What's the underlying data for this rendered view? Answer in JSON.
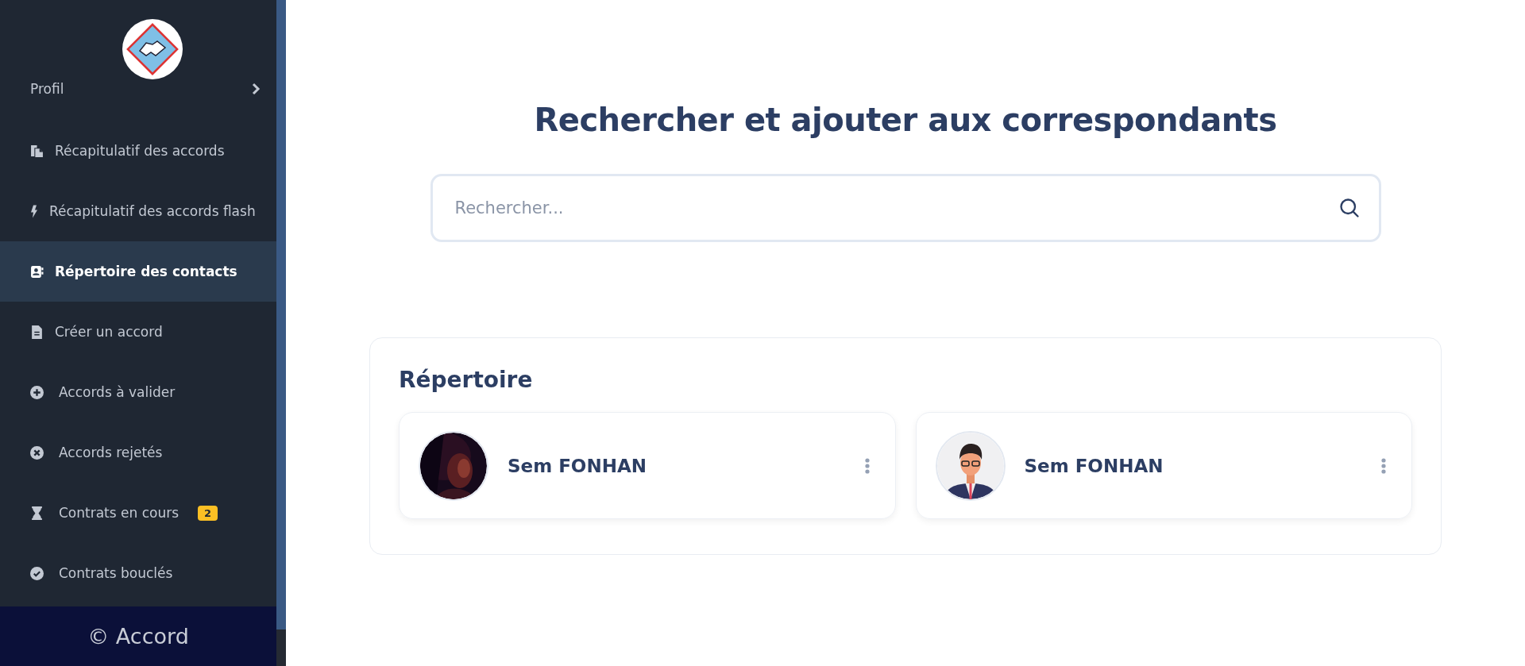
{
  "sidebar": {
    "profile": {
      "label": "Profil"
    },
    "items": [
      {
        "label": "Récapitulatif des accords",
        "selected": false
      },
      {
        "label": "Récapitulatif des accords flash",
        "selected": false
      },
      {
        "label": "Répertoire des contacts",
        "selected": true
      },
      {
        "label": "Créer un accord",
        "selected": false
      },
      {
        "label": "Accords à valider",
        "selected": false
      },
      {
        "label": "Accords rejetés",
        "selected": false
      },
      {
        "label": "Contrats en cours",
        "selected": false,
        "badge": "2"
      },
      {
        "label": "Contrats bouclés",
        "selected": false
      }
    ],
    "footer": "© Accord"
  },
  "main": {
    "title": "Rechercher et ajouter aux correspondants",
    "search": {
      "placeholder": "Rechercher..."
    },
    "directory": {
      "title": "Répertoire",
      "contacts": [
        {
          "name": "Sem FONHAN"
        },
        {
          "name": "Sem FONHAN",
          "avatar": {
            "kind": "illustration"
          }
        }
      ]
    }
  }
}
